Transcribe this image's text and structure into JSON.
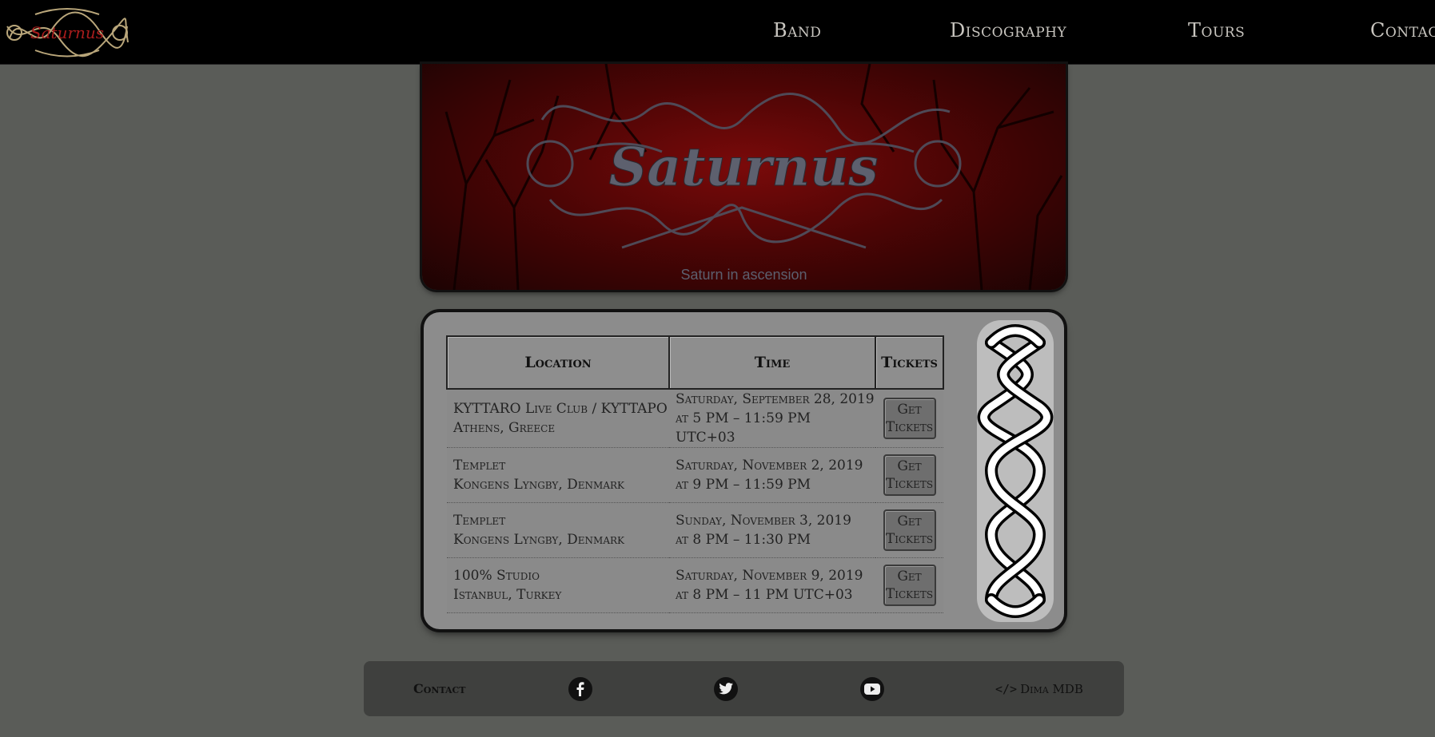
{
  "nav": {
    "logo_text": "Saturnus",
    "links": [
      "Band",
      "Discography",
      "Tours",
      "Contact"
    ]
  },
  "hero": {
    "logo_text": "Saturnus",
    "caption": "Saturn in ascension"
  },
  "tours": {
    "headers": {
      "location": "Location",
      "time": "Time",
      "tickets": "Tickets"
    },
    "rows": [
      {
        "venue": "KYTTARO Live Club / KYTTAPO",
        "city": "Athens, Greece",
        "date": "Saturday, September 28, 2019",
        "hours": "at 5 PM – 11:59 PM UTC+03",
        "ticket_label": "Get Tickets"
      },
      {
        "venue": "Templet",
        "city": "Kongens Lyngby, Denmark",
        "date": "Saturday, November 2, 2019",
        "hours": "at 9 PM – 11:59 PM",
        "ticket_label": "Get Tickets"
      },
      {
        "venue": "Templet",
        "city": "Kongens Lyngby, Denmark",
        "date": "Sunday, November 3, 2019",
        "hours": "at 8 PM – 11:30 PM",
        "ticket_label": "Get Tickets"
      },
      {
        "venue": "100% Studio",
        "city": "Istanbul, Turkey",
        "date": "Saturday, November 9, 2019",
        "hours": "at 8 PM – 11 PM UTC+03",
        "ticket_label": "Get Tickets"
      }
    ]
  },
  "footer": {
    "contact": "Contact",
    "icons": [
      "facebook-icon",
      "twitter-icon",
      "youtube-icon"
    ],
    "credit": "Dima MDB"
  },
  "colors": {
    "background": "#5a5c58",
    "navbar": "#000000",
    "hero_red": "#7a0a0a",
    "panel": "#8c8c8c",
    "footer": "#3f403e"
  }
}
